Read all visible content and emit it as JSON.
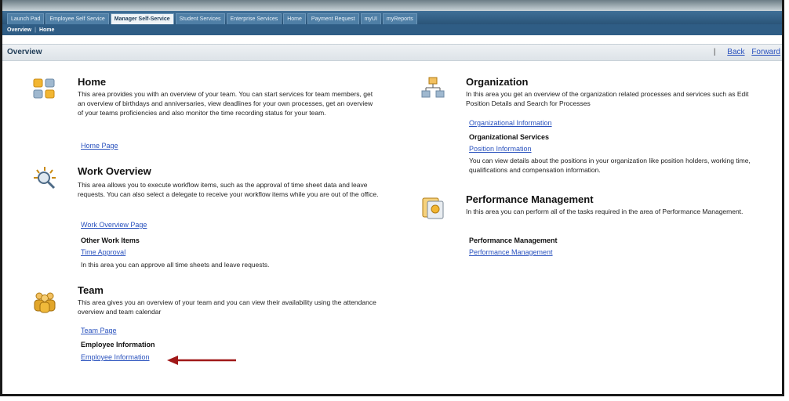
{
  "tabs": [
    "Launch Pad",
    "Employee Self Service",
    "Manager Self-Service",
    "Student Services",
    "Enterprise Services",
    "Home",
    "Payment Request",
    "myUI",
    "myReports"
  ],
  "active_tab": "Manager Self-Service",
  "subnav": [
    "Overview",
    "Home"
  ],
  "page": {
    "title": "Overview",
    "back": "Back",
    "forward": "Forward"
  },
  "home": {
    "title": "Home",
    "desc": "This area provides you with an overview of your team. You can start services for team members, get an overview of birthdays and anniversaries, view deadlines for your own processes, get an overview of your teams proficiencies and also monitor the time recording status for your team.",
    "link": "Home Page"
  },
  "work": {
    "title": "Work Overview",
    "desc": "This area allows you to execute workflow items, such as the approval of time sheet data and leave requests. You can also select a delegate to receive your workflow items while you are out of the office.",
    "link": "Work Overview Page",
    "sub_title": "Other Work Items",
    "sub_link": "Time Approval",
    "sub_desc": "In this area you can approve all time sheets and leave requests."
  },
  "team": {
    "title": "Team",
    "desc": "This area gives you an overview of your team and you can view their availability using the attendance overview and team calendar",
    "link": "Team Page",
    "sub_title": "Employee Information",
    "sub_link": "Employee Information"
  },
  "org": {
    "title": "Organization",
    "desc": "In this area you get an overview of the organization related processes and services such as Edit Position Details and Search for Processes",
    "link": "Organizational Information",
    "sub_title": "Organizational Services",
    "sub_link": "Position Information",
    "sub_desc": "You can view details about the positions in your organization like position holders, working time, qualifications and compensation information."
  },
  "perf": {
    "title": "Performance Management",
    "desc": "In this area you can perform all of the tasks required in the area of Performance Management.",
    "sub_title": "Performance Management",
    "sub_link": "Performance Management"
  },
  "colors": {
    "link": "#2a52be",
    "tabbar": "#2f5d85",
    "arrow": "#a01818"
  },
  "icons": [
    "home-icon",
    "work-overview-icon",
    "team-icon",
    "organization-icon",
    "performance-icon",
    "arrow-icon"
  ]
}
